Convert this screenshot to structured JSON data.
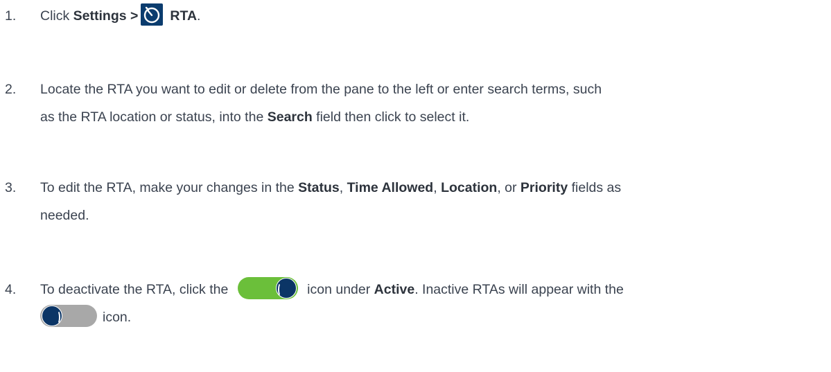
{
  "steps": [
    {
      "number": "1.",
      "t1": "Click ",
      "settings": "Settings >",
      "rta_label": "RTA",
      "end": "."
    },
    {
      "number": "2.",
      "line1": "Locate the RTA you want to edit or delete from the pane to the left or enter search terms, such",
      "line2_a": "as the RTA location or status, into the ",
      "search": "Search",
      "line2_b": " field then click to select it."
    },
    {
      "number": "3.",
      "t1": "To edit the RTA, make your changes in the ",
      "status": "Status",
      "sep1": ", ",
      "time_allowed": "Time Allowed",
      "sep2": ", ",
      "location": "Location",
      "sep3": ", or ",
      "priority": "Priority",
      "t2": " fields as",
      "line2": "needed."
    },
    {
      "number": "4.",
      "t1": "To deactivate the RTA, click the ",
      "t2": " icon under ",
      "active": "Active",
      "t3": ". Inactive RTAs will appear with the",
      "line2": "icon."
    }
  ],
  "icons": {
    "rta": "stopwatch-icon",
    "active_toggle": "toggle-on-icon",
    "inactive_toggle": "toggle-off-icon"
  },
  "colors": {
    "text": "#3b4350",
    "icon_bg": "#0b3c6e",
    "toggle_on": "#6bbf3a",
    "toggle_off": "#a8a8a8",
    "knob": "#0b3566"
  }
}
